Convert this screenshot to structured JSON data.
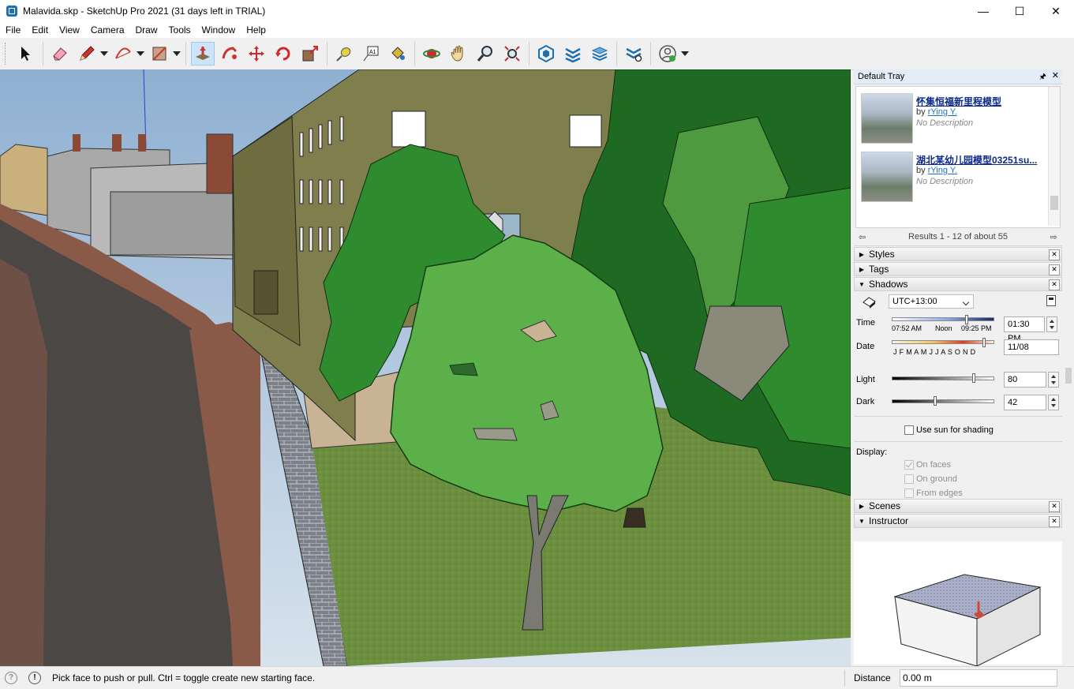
{
  "window": {
    "title": "Malavida.skp - SketchUp Pro 2021 (31 days left in TRIAL)",
    "minimize": "—",
    "maximize": "☐",
    "close": "✕"
  },
  "menu": [
    "File",
    "Edit",
    "View",
    "Camera",
    "Draw",
    "Tools",
    "Window",
    "Help"
  ],
  "toolbar": {
    "tools": [
      "select-tool",
      "eraser-tool",
      "line-tool",
      "arc-tool",
      "shape-tool",
      "push-pull-tool",
      "follow-me-tool",
      "move-tool",
      "rotate-tool",
      "scale-tool",
      "tape-measure-tool",
      "text-tool",
      "paint-bucket-tool",
      "orbit-tool",
      "pan-tool",
      "zoom-tool",
      "zoom-extents-tool",
      "warehouse-tool",
      "extension-warehouse-tool",
      "layout-tool",
      "extension-manager-tool",
      "account-tool"
    ],
    "active": "push-pull-tool"
  },
  "tray": {
    "title": "Default Tray",
    "pin": "🖈",
    "close": "✕",
    "warehouse": {
      "items": [
        {
          "name": "怀集恒福新里程模型",
          "by_prefix": "by ",
          "author": "rYing Y.",
          "description": "No Description"
        },
        {
          "name": "湖北某幼儿园模型03251su...",
          "by_prefix": "by ",
          "author": "rYing Y.",
          "description": "No Description"
        }
      ],
      "results": "Results 1 - 12 of about 55",
      "prev": "⇦",
      "next": "⇨"
    },
    "panels": {
      "styles": "Styles",
      "tags": "Tags",
      "shadows": "Shadows",
      "scenes": "Scenes",
      "instructor": "Instructor"
    },
    "shadows": {
      "timezone": "UTC+13:00",
      "time_label": "Time",
      "time_start": "07:52 AM",
      "time_noon": "Noon",
      "time_end": "09:25 PM",
      "time_value": "01:30 PM",
      "time_position": 0.73,
      "date_label": "Date",
      "months": "J  F  M  A  M  J  J  A  S  O  N  D",
      "date_value": "11/08",
      "date_position": 0.9,
      "light_label": "Light",
      "light_value": "80",
      "dark_label": "Dark",
      "dark_value": "42",
      "use_sun": "Use sun for shading",
      "display_label": "Display:",
      "on_faces": "On faces",
      "on_ground": "On ground",
      "from_edges": "From edges"
    }
  },
  "status": {
    "hint": "Pick face to push or pull.  Ctrl = toggle create new starting face.",
    "distance_label": "Distance",
    "distance_value": "0.00 m"
  },
  "colors": {
    "sky": "#a9c2dd",
    "grass": "#6b8f3f",
    "road": "#4a4745",
    "sidewalk": "#8a5a48",
    "building": "#7f7f4e",
    "tree_light": "#5bb04a",
    "tree_dark": "#1e6a22"
  }
}
